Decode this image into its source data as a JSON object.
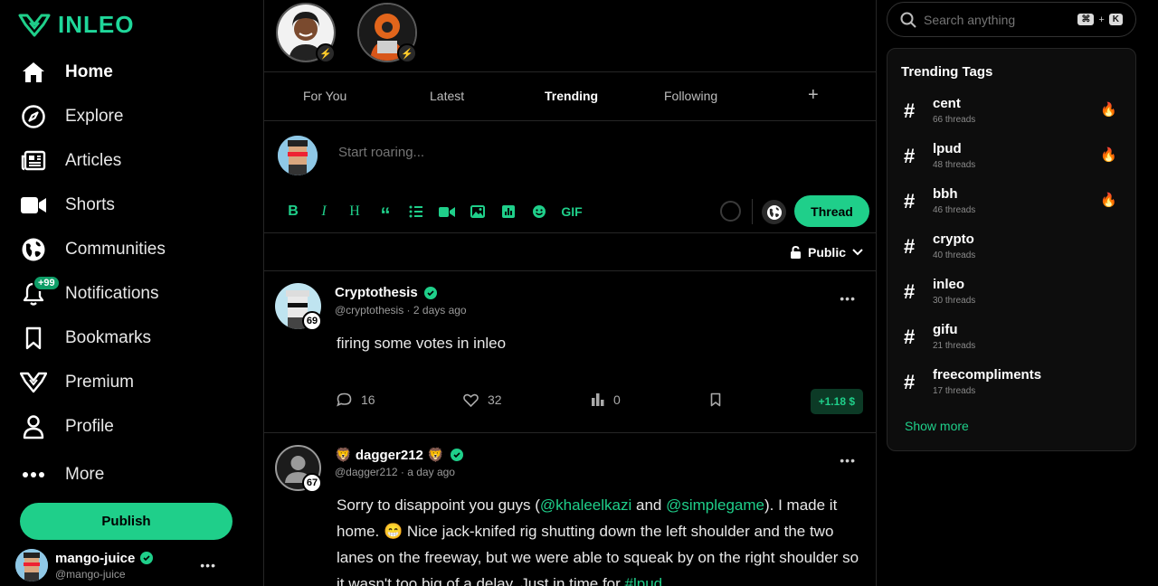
{
  "brand": {
    "name": "INLEO",
    "accent": "#1fcf8a"
  },
  "nav": [
    {
      "label": "Home",
      "icon": "home-icon",
      "active": true
    },
    {
      "label": "Explore",
      "icon": "compass-icon"
    },
    {
      "label": "Articles",
      "icon": "newspaper-icon"
    },
    {
      "label": "Shorts",
      "icon": "video-camera-icon"
    },
    {
      "label": "Communities",
      "icon": "globe-icon"
    },
    {
      "label": "Notifications",
      "icon": "bell-icon",
      "badge": "+99"
    },
    {
      "label": "Bookmarks",
      "icon": "bookmark-icon"
    },
    {
      "label": "Premium",
      "icon": "premium-icon"
    },
    {
      "label": "Profile",
      "icon": "user-icon"
    },
    {
      "label": "More",
      "icon": "dots-icon"
    }
  ],
  "publish_label": "Publish",
  "current_user": {
    "name": "mango-juice",
    "handle": "@mango-juice"
  },
  "tabs": [
    "For You",
    "Latest",
    "Trending",
    "Following"
  ],
  "active_tab": "Trending",
  "composer": {
    "placeholder": "Start roaring...",
    "gif_label": "GIF",
    "thread_label": "Thread"
  },
  "visibility": "Public",
  "posts": [
    {
      "author": "Cryptothesis",
      "handle": "@cryptothesis",
      "time": "2 days ago",
      "reputation": "69",
      "body": "firing some votes in inleo",
      "comments": "16",
      "likes": "32",
      "views": "0",
      "reward": "+1.18 $"
    },
    {
      "author": "🦁 dagger212 🦁",
      "handle": "@dagger212",
      "time": "a day ago",
      "reputation": "67",
      "body_parts": {
        "p1": "Sorry to disappoint you guys (",
        "m1": "@khaleelkazi",
        "p2": " and ",
        "m2": "@simplegame",
        "p3": "). I made it home. 😁 Nice jack-knifed rig shutting down the left shoulder and the two lanes on the freeway, but we were able to squeak by on the right shoulder so it wasn't too big of a delay. Just in time for ",
        "t1": "#lpud"
      }
    }
  ],
  "search": {
    "placeholder": "Search anything",
    "k1": "⌘",
    "plus": "+",
    "k2": "K"
  },
  "trending": {
    "title": "Trending Tags",
    "tags": [
      {
        "name": "cent",
        "count": "66 threads",
        "hot": true
      },
      {
        "name": "lpud",
        "count": "48 threads",
        "hot": true
      },
      {
        "name": "bbh",
        "count": "46 threads",
        "hot": true
      },
      {
        "name": "crypto",
        "count": "40 threads",
        "hot": false
      },
      {
        "name": "inleo",
        "count": "30 threads",
        "hot": false
      },
      {
        "name": "gifu",
        "count": "21 threads",
        "hot": false
      },
      {
        "name": "freecompliments",
        "count": "17 threads",
        "hot": false
      }
    ],
    "show_more": "Show more"
  }
}
